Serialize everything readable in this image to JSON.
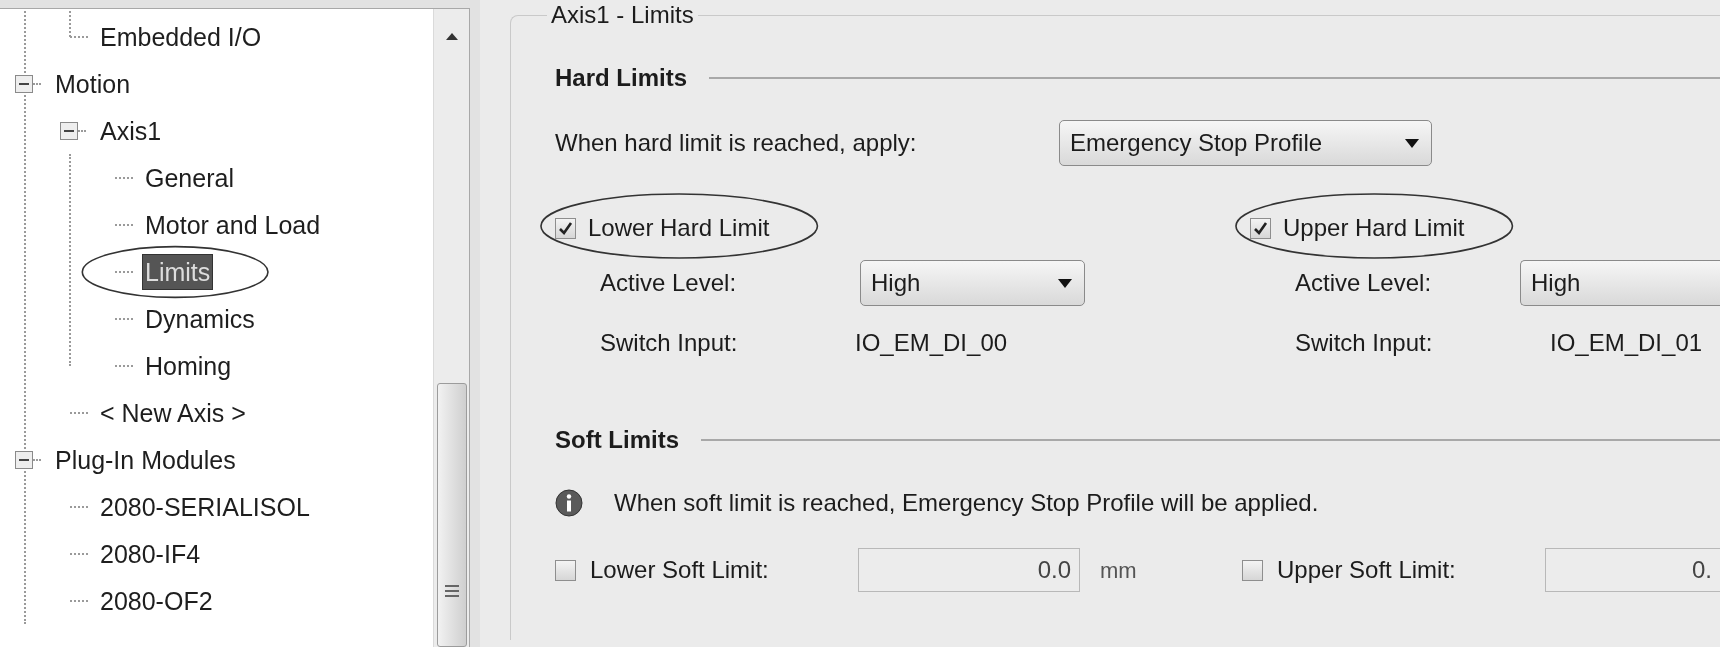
{
  "tree": {
    "scrolled_children": [
      {
        "label": "Embedded I/O",
        "kind": "leaf",
        "selected": false,
        "circled": false
      }
    ],
    "items": [
      {
        "label": "Motion",
        "kind": "group",
        "expanded": true,
        "selected": false,
        "circled": false,
        "children": [
          {
            "label": "Axis1",
            "kind": "group",
            "expanded": true,
            "selected": false,
            "circled": false,
            "children": [
              {
                "label": "General",
                "kind": "leaf",
                "selected": false,
                "circled": false
              },
              {
                "label": "Motor and Load",
                "kind": "leaf",
                "selected": false,
                "circled": false
              },
              {
                "label": "Limits",
                "kind": "leaf",
                "selected": true,
                "circled": true
              },
              {
                "label": "Dynamics",
                "kind": "leaf",
                "selected": false,
                "circled": false
              },
              {
                "label": "Homing",
                "kind": "leaf",
                "selected": false,
                "circled": false
              }
            ]
          },
          {
            "label": "< New Axis >",
            "kind": "leaf",
            "selected": false,
            "circled": false
          }
        ]
      },
      {
        "label": "Plug-In Modules",
        "kind": "group",
        "expanded": true,
        "selected": false,
        "circled": false,
        "children": [
          {
            "label": "2080-SERIALISOL",
            "kind": "leaf",
            "selected": false,
            "circled": false
          },
          {
            "label": "2080-IF4",
            "kind": "leaf",
            "selected": false,
            "circled": false
          },
          {
            "label": "2080-OF2",
            "kind": "leaf",
            "selected": false,
            "circled": false
          }
        ]
      }
    ]
  },
  "panel": {
    "title": "Axis1 - Limits",
    "hard_limits": {
      "heading": "Hard Limits",
      "apply_label": "When hard limit is reached, apply:",
      "apply_value": "Emergency Stop Profile",
      "limits": [
        {
          "label": "Lower Hard Limit",
          "checked": true,
          "circled": true,
          "clipped": false,
          "active_level_label": "Active Level:",
          "active_level": "High",
          "switch_input_label": "Switch Input:",
          "switch_input": "IO_EM_DI_00"
        },
        {
          "label": "Upper Hard Limit",
          "checked": true,
          "circled": true,
          "clipped": true,
          "active_level_label": "Active Level:",
          "active_level": "High",
          "switch_input_label": "Switch Input:",
          "switch_input": "IO_EM_DI_01"
        }
      ]
    },
    "soft_limits": {
      "heading": "Soft Limits",
      "info": "When soft limit is reached, Emergency Stop Profile will be applied.",
      "limits": [
        {
          "label": "Lower Soft Limit:",
          "checked": false,
          "clipped": false,
          "value": "0.0",
          "unit": "mm"
        },
        {
          "label": "Upper Soft Limit:",
          "checked": false,
          "clipped": true,
          "value": "0."
        }
      ]
    }
  }
}
